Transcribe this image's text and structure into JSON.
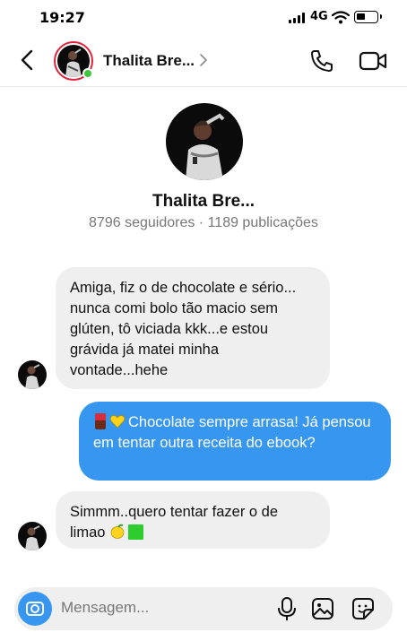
{
  "status_bar": {
    "time": "19:27",
    "network": "4G"
  },
  "header": {
    "name": "Thalita Bre...",
    "online": true
  },
  "profile": {
    "name": "Thalita Bre...",
    "stats": "8796 seguidores · 1189 publicações"
  },
  "messages": [
    {
      "direction": "incoming",
      "text": "Amiga, fiz o de chocolate e sério... nunca comi bolo tão macio sem glúten, tô viciada kkk...e estou grávida já matei minha vontade...hehe"
    },
    {
      "direction": "outgoing",
      "text": "Chocolate sempre arrasa! Já pensou em tentar outra receita do ebook?",
      "emoji_prefix": [
        "chocolate-bar-emoji",
        "yellow-heart-emoji"
      ]
    },
    {
      "direction": "incoming",
      "text": "Simmm..quero tentar fazer o de limao",
      "emoji_suffix": [
        "lemon-emoji",
        "green-square-emoji"
      ]
    }
  ],
  "composer": {
    "placeholder": "Mensagem..."
  },
  "colors": {
    "outgoing_bubble": "#3797f0",
    "incoming_bubble": "#efefef",
    "story_ring": "#e0223b",
    "online_dot": "#3ec63e"
  }
}
